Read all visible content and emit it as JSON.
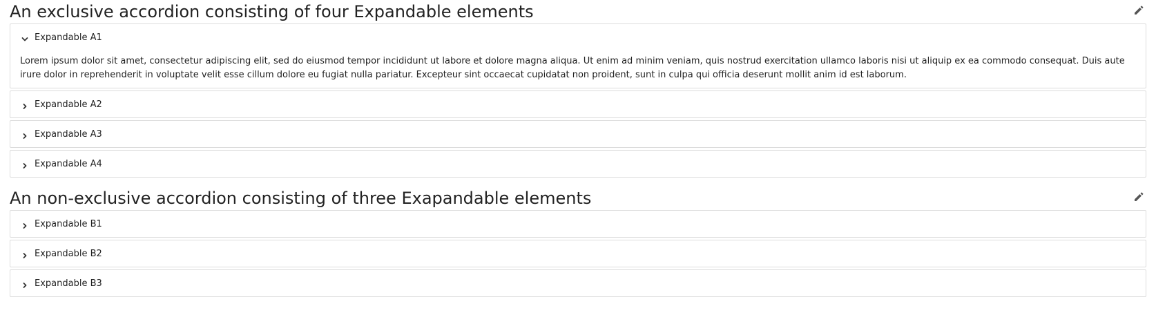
{
  "sections": [
    {
      "title": "An exclusive accordion consisting of four Expandable elements",
      "items": [
        {
          "label": "Expandable A1",
          "expanded": true,
          "content": "Lorem ipsum dolor sit amet, consectetur adipiscing elit, sed do eiusmod tempor incididunt ut labore et dolore magna aliqua. Ut enim ad minim veniam, quis nostrud exercitation ullamco laboris nisi ut aliquip ex ea commodo consequat. Duis aute irure dolor in reprehenderit in voluptate velit esse cillum dolore eu fugiat nulla pariatur. Excepteur sint occaecat cupidatat non proident, sunt in culpa qui officia deserunt mollit anim id est laborum."
        },
        {
          "label": "Expandable A2",
          "expanded": false
        },
        {
          "label": "Expandable A3",
          "expanded": false
        },
        {
          "label": "Expandable A4",
          "expanded": false
        }
      ]
    },
    {
      "title": "An non-exclusive accordion consisting of three Exapandable elements",
      "items": [
        {
          "label": "Expandable B1",
          "expanded": false
        },
        {
          "label": "Expandable B2",
          "expanded": false
        },
        {
          "label": "Expandable B3",
          "expanded": false
        }
      ]
    }
  ],
  "icons": {
    "edit": "pencil-icon",
    "expanded": "chevron-down-icon",
    "collapsed": "chevron-right-icon"
  },
  "colors": {
    "border": "#dcdcdc",
    "text": "#222222",
    "icon": "#555555"
  }
}
